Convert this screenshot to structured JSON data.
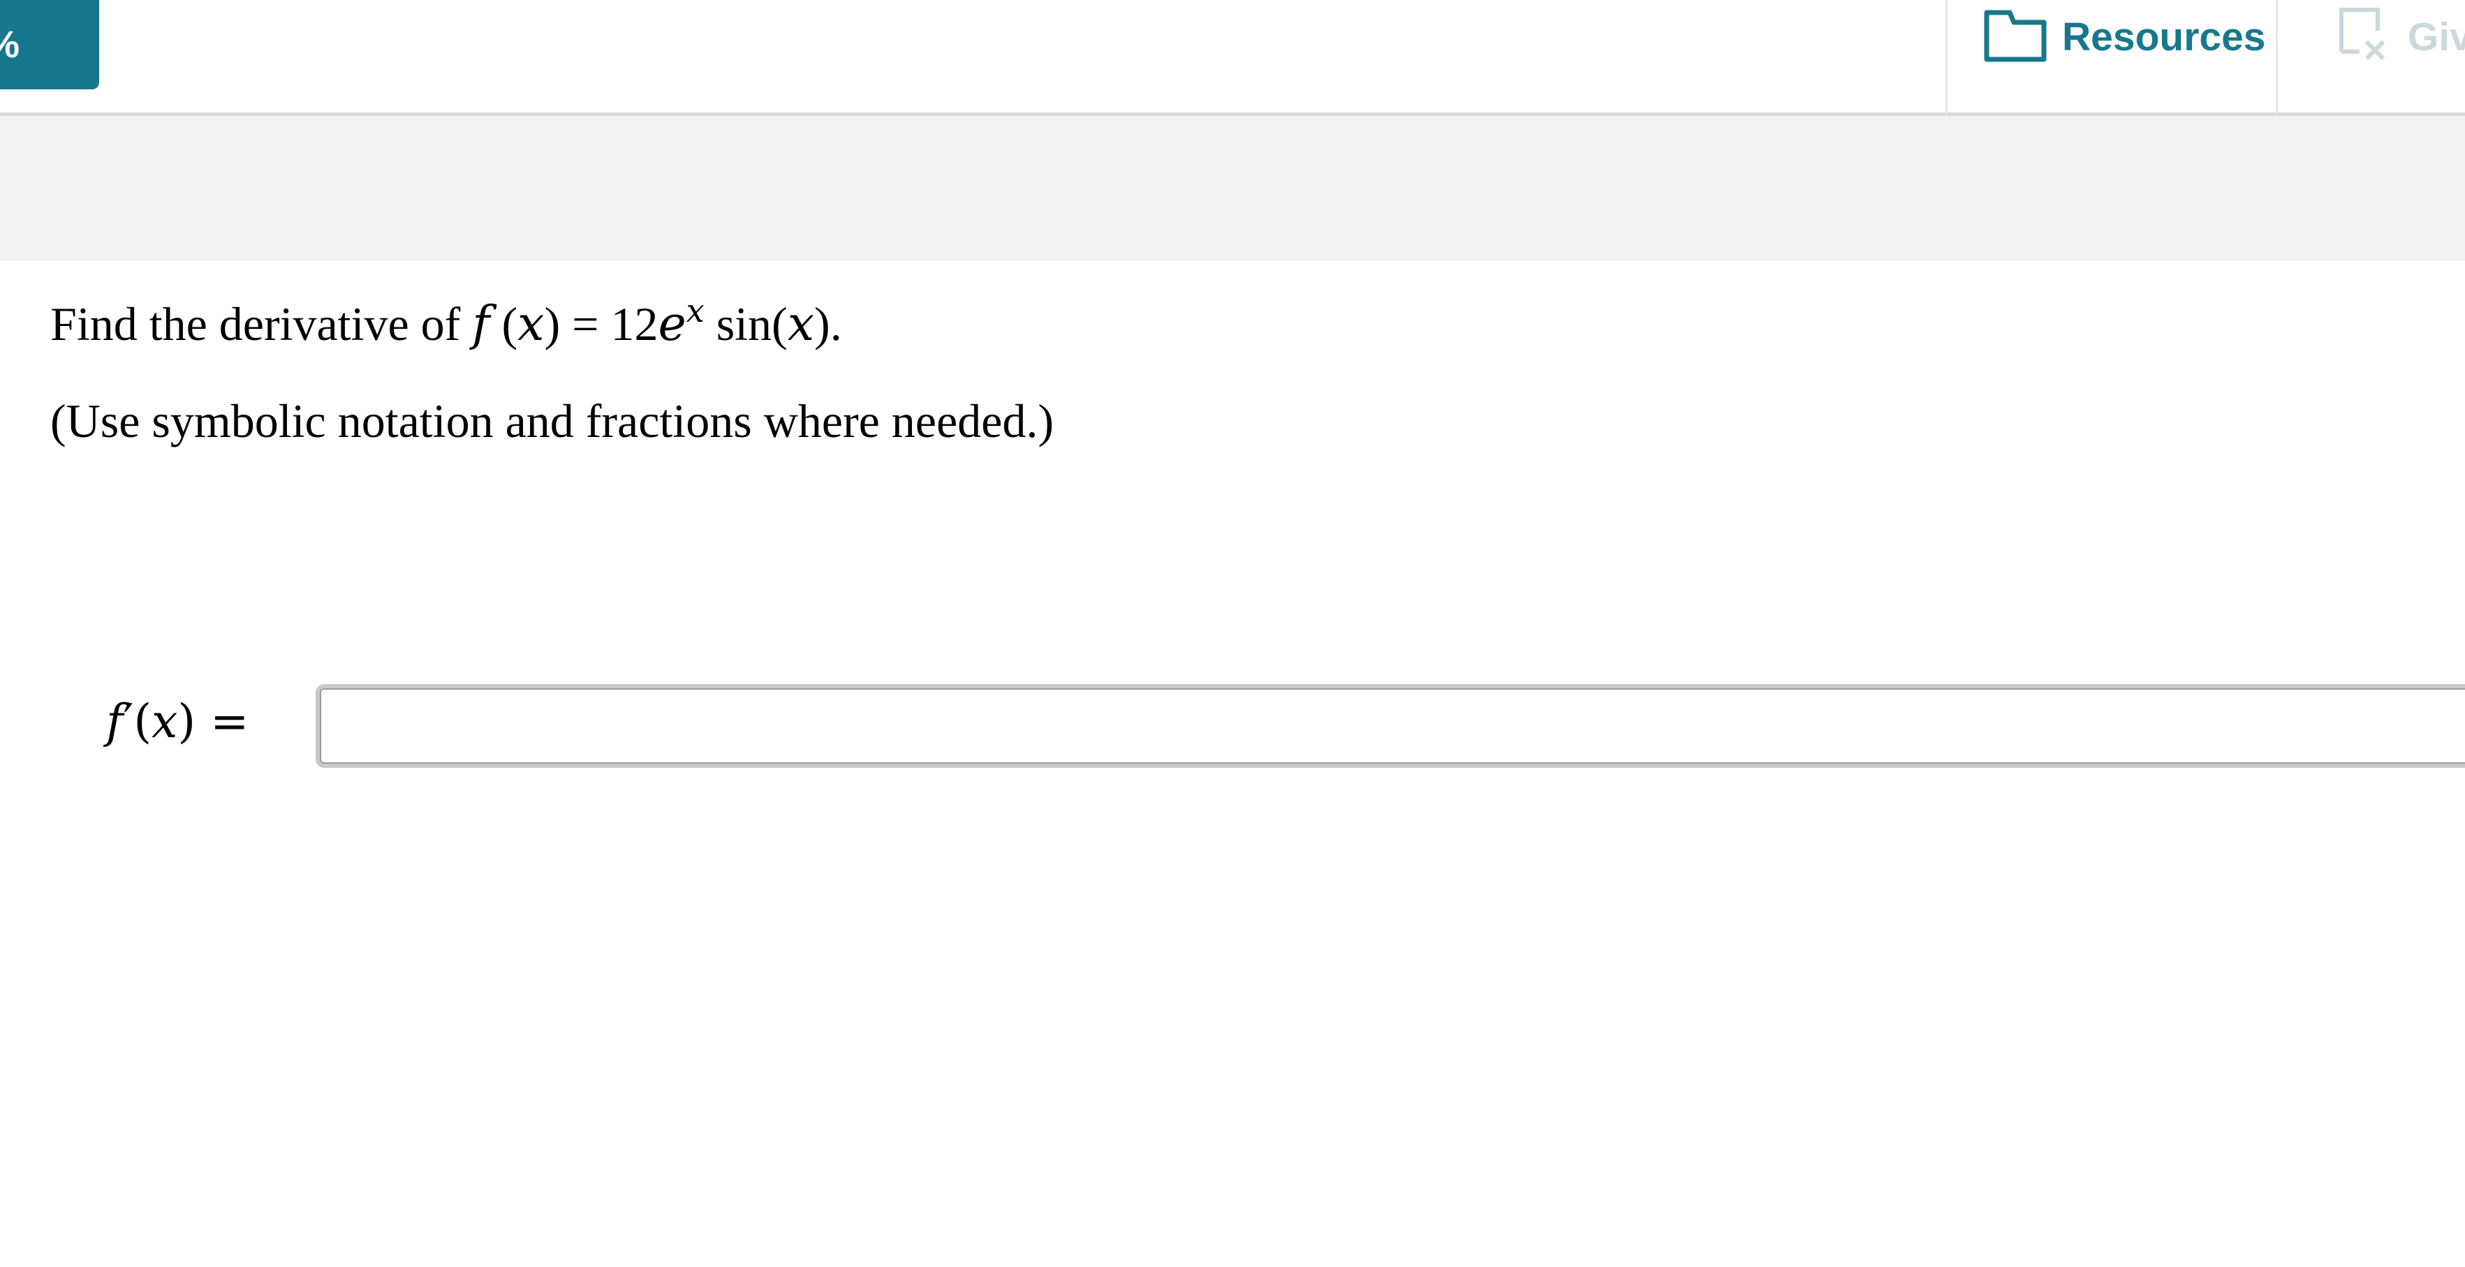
{
  "topbar": {
    "score_fragment": "%",
    "resources_label": "Resources",
    "give_up_label": "Giv",
    "resources_icon": "folder-icon",
    "give_up_icon": "give-up-icon",
    "accent_color": "#17788d",
    "disabled_color": "#cbd8dc"
  },
  "question": {
    "prefix": "Find the derivative of ",
    "func_f": "f",
    "func_open": " (",
    "func_var": "x",
    "func_close": ") = 12",
    "exp_base": "e",
    "exp_power": "x",
    "trig": " sin(",
    "trig_var": "x",
    "trig_close": ").",
    "instructions": "(Use symbolic notation and fractions where needed.)"
  },
  "answer": {
    "label_f": "f",
    "label_rest": "′(",
    "label_var": "x",
    "label_end": ") =",
    "value": "",
    "placeholder": ""
  }
}
